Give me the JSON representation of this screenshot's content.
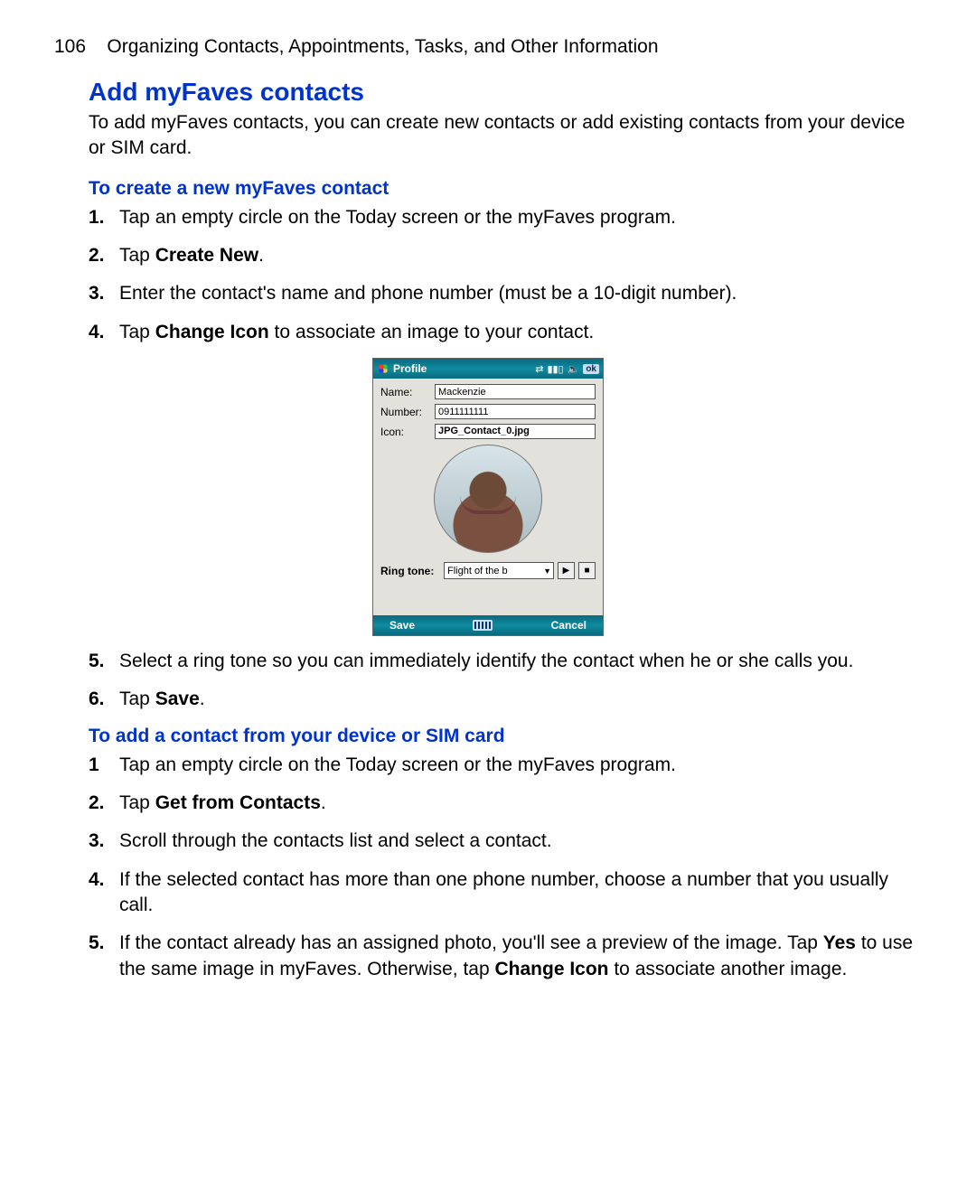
{
  "header": {
    "page_number": "106",
    "chapter_title": "Organizing Contacts, Appointments, Tasks, and Other Information"
  },
  "section_title": "Add myFaves contacts",
  "intro_text": "To add myFaves contacts, you can create new contacts or add existing contacts from your device or SIM card.",
  "sub1_title": "To create a new myFaves contact",
  "sub1_steps": {
    "s1": "Tap an empty circle on the Today screen or the myFaves program.",
    "s2_a": "Tap ",
    "s2_b": "Create New",
    "s2_c": ".",
    "s3": "Enter the contact's name and phone number (must be a 10-digit number).",
    "s4_a": "Tap ",
    "s4_b": "Change Icon",
    "s4_c": " to associate an image to your contact.",
    "s5": "Select a ring tone so you can immediately identify the contact when he or she calls you.",
    "s6_a": "Tap ",
    "s6_b": "Save",
    "s6_c": "."
  },
  "sub2_title": "To add a contact from your device or SIM card",
  "sub2_steps": {
    "s1": "Tap an empty circle on the Today screen or the myFaves program.",
    "s2_a": "Tap ",
    "s2_b": "Get from Contacts",
    "s2_c": ".",
    "s3": "Scroll through the contacts list and select a contact.",
    "s4": "If the selected contact has more than one phone number, choose a number that you usually call.",
    "s5_a": "If the contact already has an assigned photo, you'll see a preview of the image. Tap ",
    "s5_b": "Yes",
    "s5_c": " to use the same image in myFaves. Otherwise, tap ",
    "s5_d": "Change Icon",
    "s5_e": " to associate another image."
  },
  "device": {
    "title": "Profile",
    "ok": "ok",
    "labels": {
      "name": "Name:",
      "number": "Number:",
      "icon": "Icon:",
      "ringtone": "Ring tone:"
    },
    "values": {
      "name": "Mackenzie",
      "number": "0911111111",
      "icon": "JPG_Contact_0.jpg",
      "ringtone": "Flight of the b"
    },
    "bottom": {
      "save": "Save",
      "cancel": "Cancel"
    }
  },
  "nums": {
    "n1": "1.",
    "n1nd": "1",
    "n2": "2.",
    "n3": "3.",
    "n4": "4.",
    "n5": "5.",
    "n6": "6."
  }
}
